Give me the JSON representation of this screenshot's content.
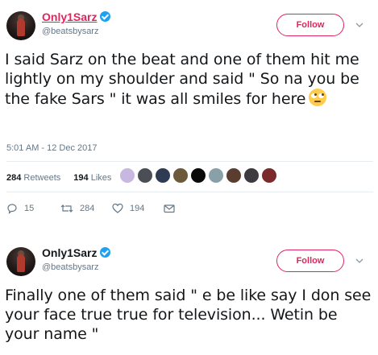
{
  "tweets": [
    {
      "display_name": "Only1Sarz",
      "handle": "@beatsbysarz",
      "follow_label": "Follow",
      "text": "I said Sarz on the beat and one of them hit me lightly on my shoulder and said \" So na you be the fake Sars \" it was all smiles for here",
      "emoji": "face-with-rolling-eyes",
      "timestamp": "5:01 AM - 12 Dec 2017",
      "stats": {
        "retweets_count": "284",
        "retweets_label": "Retweets",
        "likes_count": "194",
        "likes_label": "Likes"
      },
      "actions": {
        "replies": "15",
        "retweets": "284",
        "likes": "194"
      }
    },
    {
      "display_name": "Only1Sarz",
      "handle": "@beatsbysarz",
      "follow_label": "Follow",
      "text": "Finally one of them said \" e be like say I don see your face true true for television... Wetin be your name \""
    }
  ],
  "colors": {
    "accent": "#e0245e",
    "verified": "#1da1f2",
    "muted": "#657786",
    "text": "#14171a"
  }
}
